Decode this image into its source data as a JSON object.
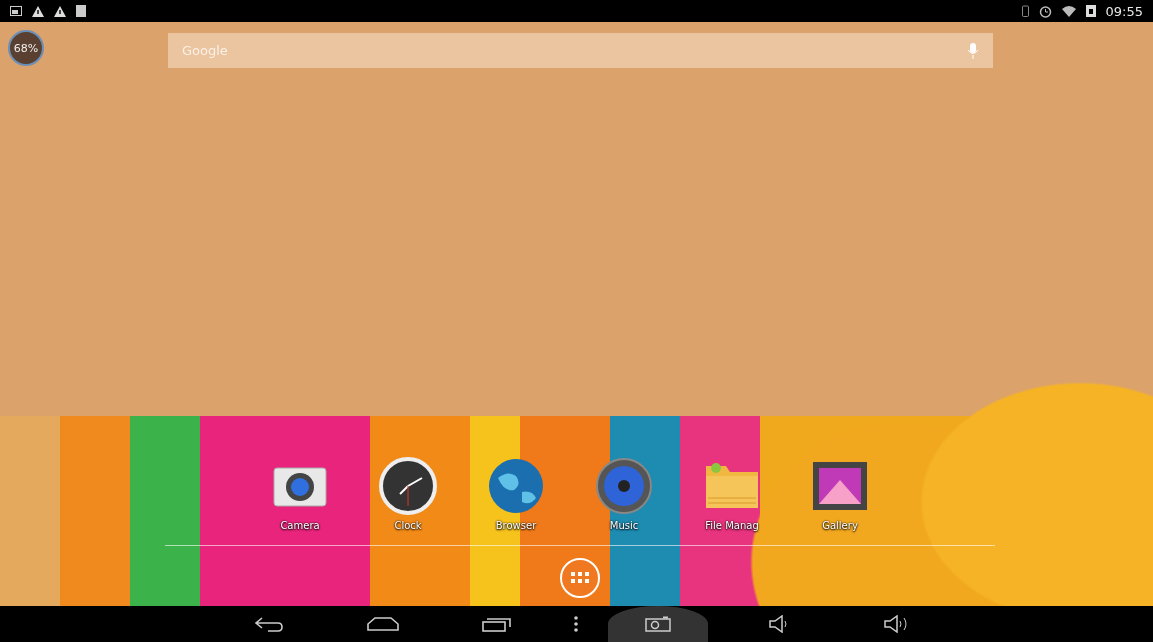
{
  "status_bar": {
    "time": "09:55"
  },
  "battery_badge": {
    "label": "68%"
  },
  "search": {
    "placeholder": "Google"
  },
  "dock": [
    {
      "label": "Camera",
      "kind": "camera"
    },
    {
      "label": "Clock",
      "kind": "clock"
    },
    {
      "label": "Browser",
      "kind": "browser"
    },
    {
      "label": "Music",
      "kind": "music"
    },
    {
      "label": "File Manag",
      "kind": "files"
    },
    {
      "label": "Gallery",
      "kind": "gallery"
    }
  ]
}
